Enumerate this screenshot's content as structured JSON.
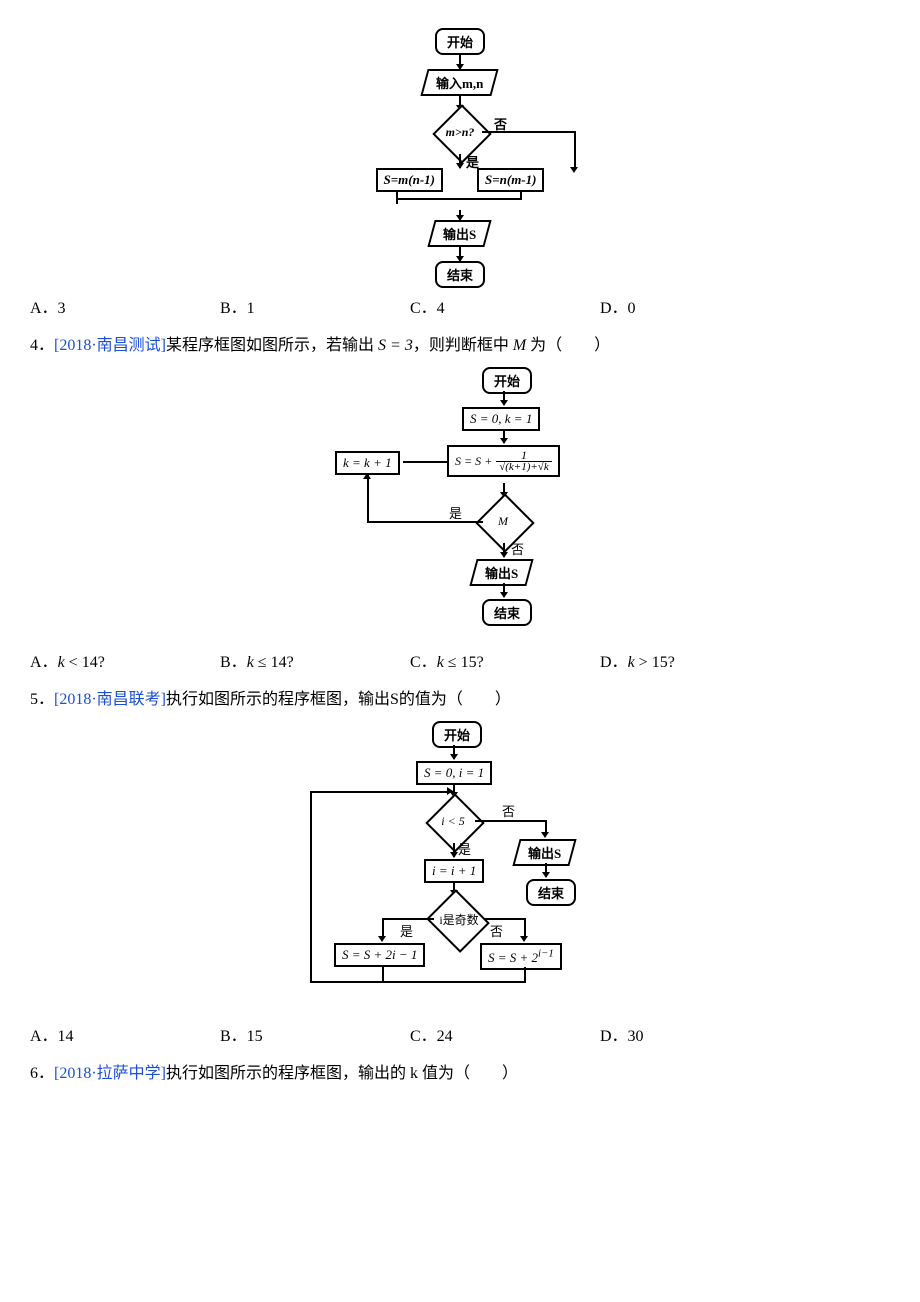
{
  "q3": {
    "fc": {
      "start": "开始",
      "input": "输入m,n",
      "cond": "m>n?",
      "yes": "是",
      "no": "否",
      "left": "S=m(n-1)",
      "right": "S=n(m-1)",
      "output": "输出S",
      "end": "结束"
    },
    "options": {
      "A": "A．3",
      "B": "B．1",
      "C": "C．4",
      "D": "D．0"
    }
  },
  "q4": {
    "num": "4．",
    "source": "[2018·南昌测试]",
    "text_before": "某程序框图如图所示，若输出 ",
    "s_eq": "S = 3",
    "text_mid": "，则判断框中 ",
    "m_var": "M",
    "text_after": " 为（　　）",
    "fc": {
      "start": "开始",
      "init": "S = 0, k = 1",
      "inc": "k = k + 1",
      "sum": "S = S + 1/(√(k+1)+√k)",
      "cond": "M",
      "yes": "是",
      "no": "否",
      "output": "输出S",
      "end": "结束"
    },
    "options": {
      "A": "A．k < 14?",
      "B": "B．k ≤ 14?",
      "C": "C．k ≤ 15?",
      "D": "D．k > 15?"
    }
  },
  "q5": {
    "num": "5．",
    "source": "[2018·南昌联考]",
    "text": "执行如图所示的程序框图，输出S的值为（　　）",
    "fc": {
      "start": "开始",
      "init": "S = 0, i = 1",
      "cond1": "i < 5",
      "yes": "是",
      "no": "否",
      "inc": "i = i + 1",
      "cond2": "i是奇数",
      "left": "S = S + 2i − 1",
      "right": "S = S + 2^(i-1)",
      "output": "输出S",
      "end": "结束"
    },
    "options": {
      "A": "A．14",
      "B": "B．15",
      "C": "C．24",
      "D": "D．30"
    }
  },
  "q6": {
    "num": "6．",
    "source": "[2018·拉萨中学]",
    "text": "执行如图所示的程序框图，输出的 k 值为（　　）"
  }
}
